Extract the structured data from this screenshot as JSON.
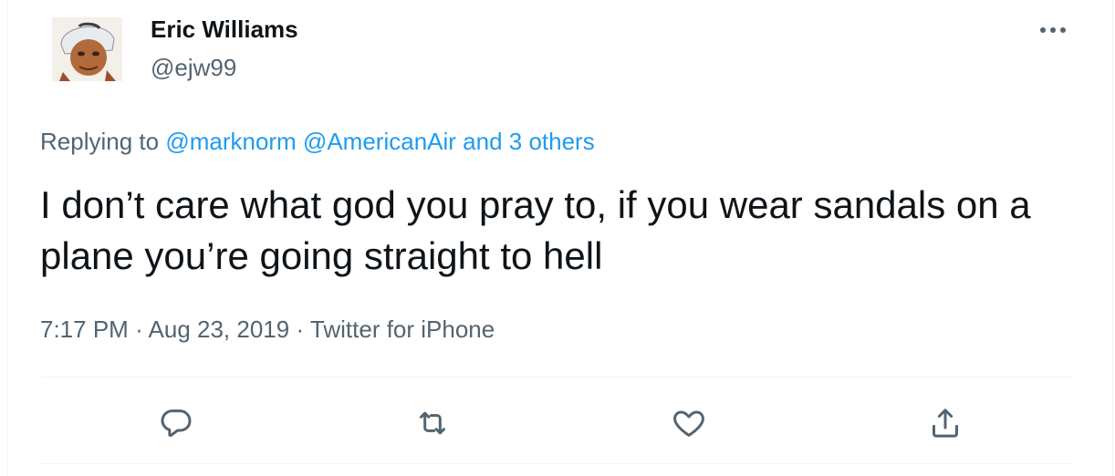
{
  "tweet": {
    "author_name": "Eric Williams",
    "author_handle": "@ejw99",
    "replying_prefix": "Replying to",
    "replying_to": "@marknorm @AmericanAir and 3 others",
    "text": "I don’t care what god you pray to, if you wear sandals on a plane you’re going straight to hell",
    "time": "7:17 PM",
    "date": "Aug 23, 2019",
    "source": "Twitter for iPhone",
    "separator": "·"
  },
  "icons": {
    "more": "more-icon",
    "reply": "reply-icon",
    "retweet": "retweet-icon",
    "like": "like-icon",
    "share": "share-icon"
  },
  "colors": {
    "text": "#0f1419",
    "secondary": "#536471",
    "link": "#1d9bf0",
    "divider": "#eff3f4"
  }
}
